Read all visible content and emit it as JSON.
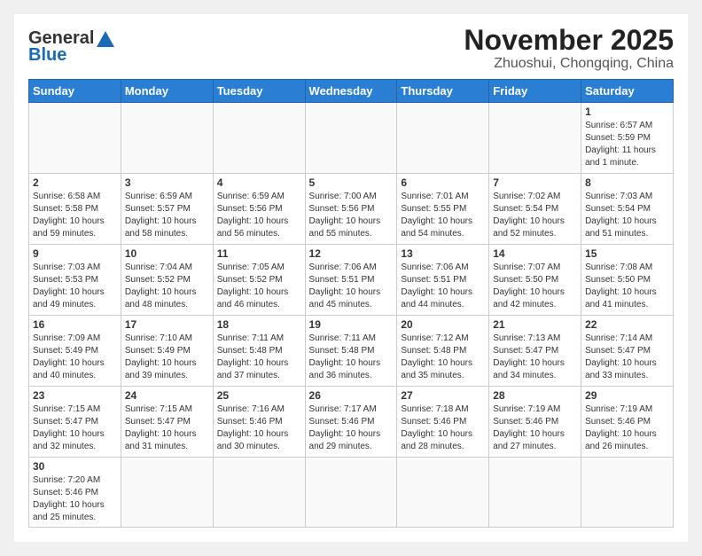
{
  "header": {
    "logo_general": "General",
    "logo_blue": "Blue",
    "month_title": "November 2025",
    "location": "Zhuoshui, Chongqing, China"
  },
  "weekdays": [
    "Sunday",
    "Monday",
    "Tuesday",
    "Wednesday",
    "Thursday",
    "Friday",
    "Saturday"
  ],
  "weeks": [
    [
      {
        "day": "",
        "sunrise": "",
        "sunset": "",
        "daylight": ""
      },
      {
        "day": "",
        "sunrise": "",
        "sunset": "",
        "daylight": ""
      },
      {
        "day": "",
        "sunrise": "",
        "sunset": "",
        "daylight": ""
      },
      {
        "day": "",
        "sunrise": "",
        "sunset": "",
        "daylight": ""
      },
      {
        "day": "",
        "sunrise": "",
        "sunset": "",
        "daylight": ""
      },
      {
        "day": "",
        "sunrise": "",
        "sunset": "",
        "daylight": ""
      },
      {
        "day": "1",
        "sunrise": "Sunrise: 6:57 AM",
        "sunset": "Sunset: 5:59 PM",
        "daylight": "Daylight: 11 hours and 1 minute."
      }
    ],
    [
      {
        "day": "2",
        "sunrise": "Sunrise: 6:58 AM",
        "sunset": "Sunset: 5:58 PM",
        "daylight": "Daylight: 10 hours and 59 minutes."
      },
      {
        "day": "3",
        "sunrise": "Sunrise: 6:59 AM",
        "sunset": "Sunset: 5:57 PM",
        "daylight": "Daylight: 10 hours and 58 minutes."
      },
      {
        "day": "4",
        "sunrise": "Sunrise: 6:59 AM",
        "sunset": "Sunset: 5:56 PM",
        "daylight": "Daylight: 10 hours and 56 minutes."
      },
      {
        "day": "5",
        "sunrise": "Sunrise: 7:00 AM",
        "sunset": "Sunset: 5:56 PM",
        "daylight": "Daylight: 10 hours and 55 minutes."
      },
      {
        "day": "6",
        "sunrise": "Sunrise: 7:01 AM",
        "sunset": "Sunset: 5:55 PM",
        "daylight": "Daylight: 10 hours and 54 minutes."
      },
      {
        "day": "7",
        "sunrise": "Sunrise: 7:02 AM",
        "sunset": "Sunset: 5:54 PM",
        "daylight": "Daylight: 10 hours and 52 minutes."
      },
      {
        "day": "8",
        "sunrise": "Sunrise: 7:03 AM",
        "sunset": "Sunset: 5:54 PM",
        "daylight": "Daylight: 10 hours and 51 minutes."
      }
    ],
    [
      {
        "day": "9",
        "sunrise": "Sunrise: 7:03 AM",
        "sunset": "Sunset: 5:53 PM",
        "daylight": "Daylight: 10 hours and 49 minutes."
      },
      {
        "day": "10",
        "sunrise": "Sunrise: 7:04 AM",
        "sunset": "Sunset: 5:52 PM",
        "daylight": "Daylight: 10 hours and 48 minutes."
      },
      {
        "day": "11",
        "sunrise": "Sunrise: 7:05 AM",
        "sunset": "Sunset: 5:52 PM",
        "daylight": "Daylight: 10 hours and 46 minutes."
      },
      {
        "day": "12",
        "sunrise": "Sunrise: 7:06 AM",
        "sunset": "Sunset: 5:51 PM",
        "daylight": "Daylight: 10 hours and 45 minutes."
      },
      {
        "day": "13",
        "sunrise": "Sunrise: 7:06 AM",
        "sunset": "Sunset: 5:51 PM",
        "daylight": "Daylight: 10 hours and 44 minutes."
      },
      {
        "day": "14",
        "sunrise": "Sunrise: 7:07 AM",
        "sunset": "Sunset: 5:50 PM",
        "daylight": "Daylight: 10 hours and 42 minutes."
      },
      {
        "day": "15",
        "sunrise": "Sunrise: 7:08 AM",
        "sunset": "Sunset: 5:50 PM",
        "daylight": "Daylight: 10 hours and 41 minutes."
      }
    ],
    [
      {
        "day": "16",
        "sunrise": "Sunrise: 7:09 AM",
        "sunset": "Sunset: 5:49 PM",
        "daylight": "Daylight: 10 hours and 40 minutes."
      },
      {
        "day": "17",
        "sunrise": "Sunrise: 7:10 AM",
        "sunset": "Sunset: 5:49 PM",
        "daylight": "Daylight: 10 hours and 39 minutes."
      },
      {
        "day": "18",
        "sunrise": "Sunrise: 7:11 AM",
        "sunset": "Sunset: 5:48 PM",
        "daylight": "Daylight: 10 hours and 37 minutes."
      },
      {
        "day": "19",
        "sunrise": "Sunrise: 7:11 AM",
        "sunset": "Sunset: 5:48 PM",
        "daylight": "Daylight: 10 hours and 36 minutes."
      },
      {
        "day": "20",
        "sunrise": "Sunrise: 7:12 AM",
        "sunset": "Sunset: 5:48 PM",
        "daylight": "Daylight: 10 hours and 35 minutes."
      },
      {
        "day": "21",
        "sunrise": "Sunrise: 7:13 AM",
        "sunset": "Sunset: 5:47 PM",
        "daylight": "Daylight: 10 hours and 34 minutes."
      },
      {
        "day": "22",
        "sunrise": "Sunrise: 7:14 AM",
        "sunset": "Sunset: 5:47 PM",
        "daylight": "Daylight: 10 hours and 33 minutes."
      }
    ],
    [
      {
        "day": "23",
        "sunrise": "Sunrise: 7:15 AM",
        "sunset": "Sunset: 5:47 PM",
        "daylight": "Daylight: 10 hours and 32 minutes."
      },
      {
        "day": "24",
        "sunrise": "Sunrise: 7:15 AM",
        "sunset": "Sunset: 5:47 PM",
        "daylight": "Daylight: 10 hours and 31 minutes."
      },
      {
        "day": "25",
        "sunrise": "Sunrise: 7:16 AM",
        "sunset": "Sunset: 5:46 PM",
        "daylight": "Daylight: 10 hours and 30 minutes."
      },
      {
        "day": "26",
        "sunrise": "Sunrise: 7:17 AM",
        "sunset": "Sunset: 5:46 PM",
        "daylight": "Daylight: 10 hours and 29 minutes."
      },
      {
        "day": "27",
        "sunrise": "Sunrise: 7:18 AM",
        "sunset": "Sunset: 5:46 PM",
        "daylight": "Daylight: 10 hours and 28 minutes."
      },
      {
        "day": "28",
        "sunrise": "Sunrise: 7:19 AM",
        "sunset": "Sunset: 5:46 PM",
        "daylight": "Daylight: 10 hours and 27 minutes."
      },
      {
        "day": "29",
        "sunrise": "Sunrise: 7:19 AM",
        "sunset": "Sunset: 5:46 PM",
        "daylight": "Daylight: 10 hours and 26 minutes."
      }
    ],
    [
      {
        "day": "30",
        "sunrise": "Sunrise: 7:20 AM",
        "sunset": "Sunset: 5:46 PM",
        "daylight": "Daylight: 10 hours and 25 minutes."
      },
      {
        "day": "",
        "sunrise": "",
        "sunset": "",
        "daylight": ""
      },
      {
        "day": "",
        "sunrise": "",
        "sunset": "",
        "daylight": ""
      },
      {
        "day": "",
        "sunrise": "",
        "sunset": "",
        "daylight": ""
      },
      {
        "day": "",
        "sunrise": "",
        "sunset": "",
        "daylight": ""
      },
      {
        "day": "",
        "sunrise": "",
        "sunset": "",
        "daylight": ""
      },
      {
        "day": "",
        "sunrise": "",
        "sunset": "",
        "daylight": ""
      }
    ]
  ]
}
